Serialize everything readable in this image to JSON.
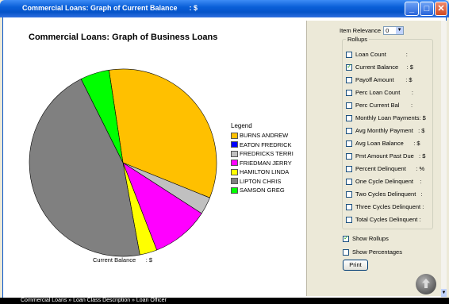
{
  "window": {
    "title": "Commercial Loans: Graph of Current Balance      : $"
  },
  "chart": {
    "title": "Commercial Loans: Graph of Business Loans",
    "footer_label": "Current Balance      : $"
  },
  "chart_data": {
    "type": "pie",
    "title": "Commercial Loans: Graph of Business Loans",
    "legend_title": "Legend",
    "legend_position": "right",
    "slices": [
      {
        "name": "BURNS ANDREW",
        "value": 33.5,
        "color": "#ffc000"
      },
      {
        "name": "EATON FREDRICK",
        "value": 0.0,
        "color": "#0000ff"
      },
      {
        "name": "FREDRICKS TERRI",
        "value": 3.0,
        "color": "#c0c0c0"
      },
      {
        "name": "FRIEDMAN JERRY",
        "value": 10.0,
        "color": "#ff00ff"
      },
      {
        "name": "HAMILTON LINDA",
        "value": 3.0,
        "color": "#ffff00"
      },
      {
        "name": "LIPTON CHRIS",
        "value": 45.5,
        "color": "#808080"
      },
      {
        "name": "SAMSON GREG",
        "value": 5.0,
        "color": "#00ff00"
      }
    ]
  },
  "panel": {
    "relevance_label": "Item Relevance",
    "relevance_value": "0",
    "rollups_title": "Rollups",
    "rollups": [
      {
        "label": "Loan Count            :",
        "checked": false
      },
      {
        "label": "Current Balance     : $",
        "checked": true
      },
      {
        "label": "Payoff Amount       : $",
        "checked": false
      },
      {
        "label": "Perc Loan Count       :",
        "checked": false
      },
      {
        "label": "Perc Current Bal       :",
        "checked": false
      },
      {
        "label": "Monthly Loan Payments: $",
        "checked": false
      },
      {
        "label": "Avg Monthly Payment   : $",
        "checked": false
      },
      {
        "label": "Avg Loan Balance      : $",
        "checked": false
      },
      {
        "label": "Pmt Amount Past Due   : $",
        "checked": false
      },
      {
        "label": "Percent Delinquent      : %",
        "checked": false
      },
      {
        "label": "One Cycle Delinquent    :",
        "checked": false
      },
      {
        "label": "Two Cycles Delinquent   :",
        "checked": false
      },
      {
        "label": "Three Cycles Delinquent :",
        "checked": false
      },
      {
        "label": "Total Cycles Delinquent :",
        "checked": false
      }
    ],
    "show_rollups_label": "Show Rollups",
    "show_rollups_checked": true,
    "show_percentages_label": "Show Percentages",
    "show_percentages_checked": false,
    "print_label": "Print"
  },
  "statusbar": {
    "breadcrumb": "Commercial Loans » Loan Class Description » Loan Officer"
  }
}
